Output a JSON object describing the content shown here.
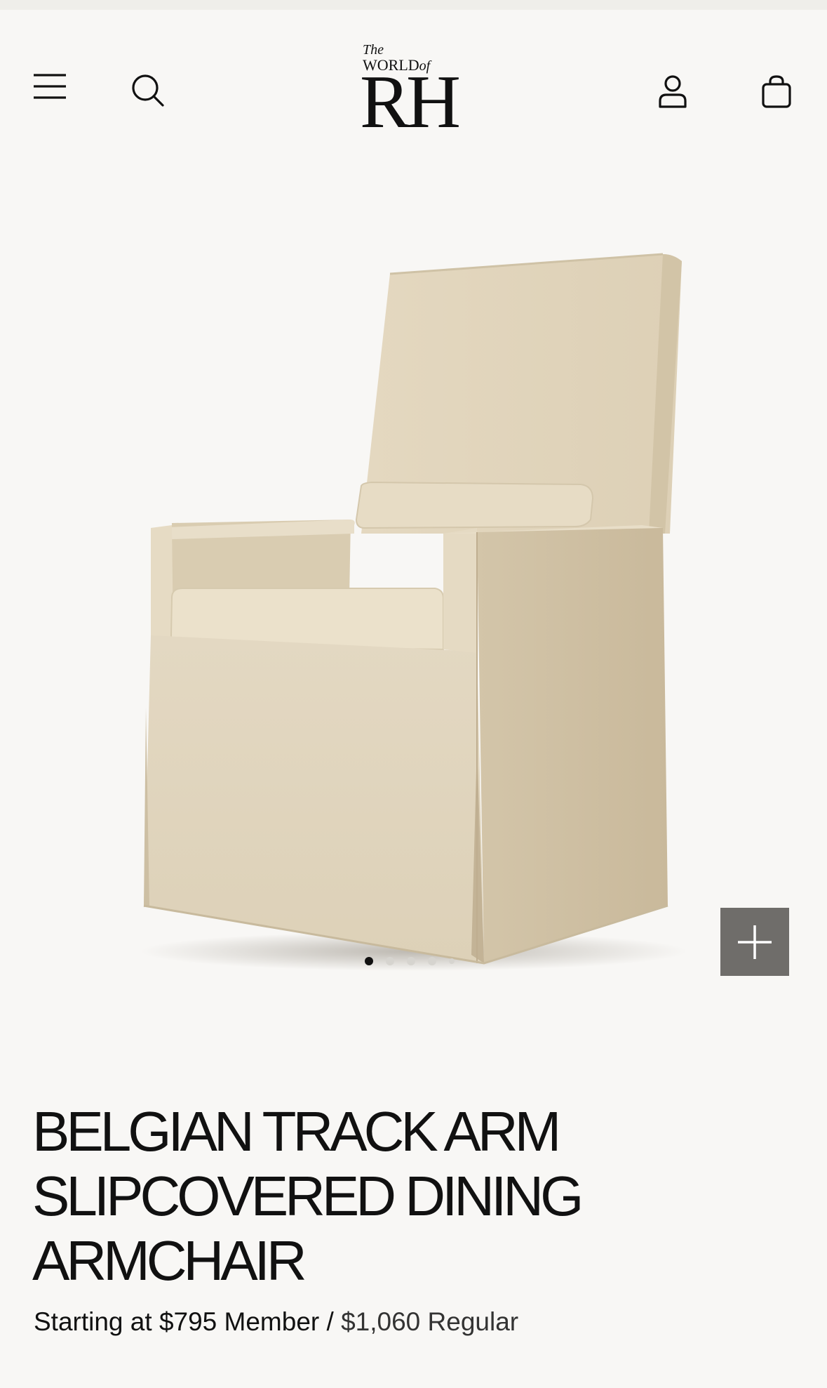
{
  "header": {
    "logo_text_the": "The",
    "logo_text_world": "WORLD",
    "logo_text_of": "of",
    "logo_text_rh": "RH"
  },
  "icons": {
    "menu": "hamburger-menu-icon",
    "search": "search-icon",
    "account": "account-icon",
    "bag": "shopping-bag-icon",
    "zoom": "plus-icon"
  },
  "carousel": {
    "current_index": 1,
    "total_dots": 5
  },
  "product": {
    "title_line1": "BELGIAN TRACK ARM",
    "title_line2": "SLIPCOVERED DINING",
    "title_line3": "ARMCHAIR",
    "price_prefix": "Starting at",
    "member_price": "$795",
    "member_label": "Member",
    "separator": "/",
    "regular_price": "$1,060",
    "regular_label": "Regular"
  },
  "colors": {
    "background": "#f8f7f5",
    "zoom_button": "#6f6d6a",
    "fabric": "#e3d8c2"
  }
}
